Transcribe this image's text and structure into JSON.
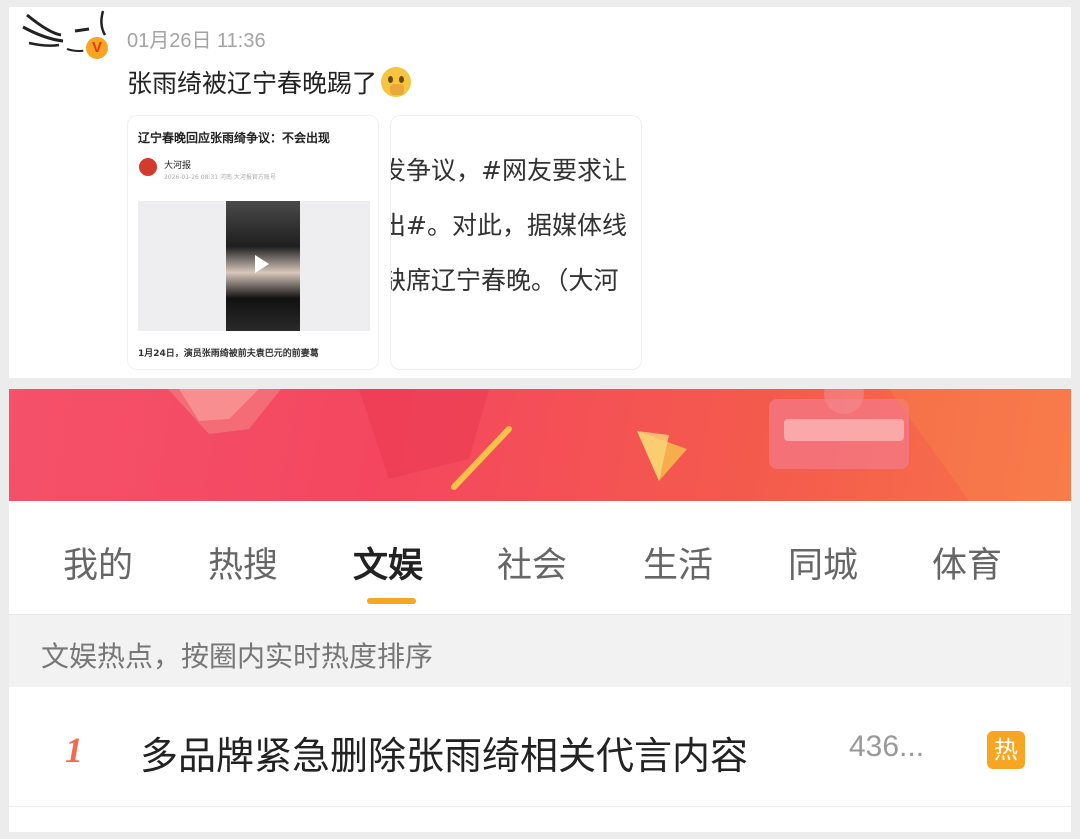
{
  "post": {
    "time": "01月26日 11:36",
    "text": "张雨绮被辽宁春晚踢了",
    "emoji": "shushing-face-emoji",
    "avatar_badge": "V",
    "thumbnail_1": {
      "title": "辽宁春晚回应张雨绮争议：不会出现",
      "source": "大河报",
      "meta": "2026-01-26 08:31  河南  大河报官方账号",
      "body": "1月24日，演员张雨绮被前夫袁巴元的前妻葛"
    },
    "thumbnail_2": {
      "lines": [
        "发争议，#网友要求让",
        "出#。对此，据媒体线",
        "缺席辽宁春晚。（大河"
      ]
    }
  },
  "hot": {
    "tabs": [
      {
        "label": "我的"
      },
      {
        "label": "热搜"
      },
      {
        "label": "文娱"
      },
      {
        "label": "社会"
      },
      {
        "label": "生活"
      },
      {
        "label": "同城"
      },
      {
        "label": "体育"
      }
    ],
    "active_tab": "文娱",
    "section_caption": "文娱热点，按圈内实时热度排序",
    "items": [
      {
        "rank": "1",
        "title": "多品牌紧急删除张雨绮相关代言内容",
        "count": "436...",
        "badge": "热"
      }
    ]
  },
  "colors": {
    "accent_orange": "#f6a623",
    "rank_red": "#f26a4f",
    "banner_red": "#f4475f"
  }
}
